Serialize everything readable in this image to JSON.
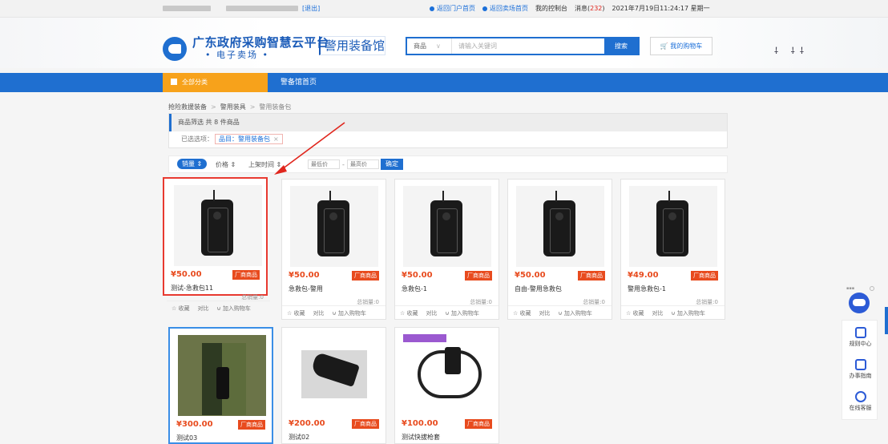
{
  "topbar": {
    "logout": "[退出]",
    "links": [
      "返回门户首页",
      "返回卖场首页",
      "我的控制台"
    ],
    "messages_label": "消息(",
    "messages_count": "232",
    "messages_close": ")",
    "datetime": "2021年7月19日11:24:17 星期一"
  },
  "header": {
    "title": "广东政府采购智慧云平台",
    "subtitle": "• 电子卖场 •",
    "section": "警用装备馆",
    "search": {
      "category": "商品",
      "placeholder": "请输入关键词",
      "button": "搜索"
    },
    "cart": "我的购物车"
  },
  "nav": {
    "all": "全部分类",
    "home": "警备馆首页"
  },
  "breadcrumb": [
    "抢险救援装备",
    "警用装具",
    "警用装备包"
  ],
  "filter": {
    "result_label": "商品筛选 共 8 件商品",
    "selected_label": "已选选项：",
    "selected_tag": "品目：警用装备包"
  },
  "sort": {
    "options": [
      "销量",
      "价格",
      "上架时间"
    ],
    "price_min_placeholder": "最低价",
    "price_max_placeholder": "最高价",
    "confirm": "确定"
  },
  "products": [
    {
      "name": "测试-急救包11",
      "price": "¥50.00",
      "badge": "厂商商品",
      "sold": "总销量:0"
    },
    {
      "name": "急救包-警用",
      "price": "¥50.00",
      "badge": "厂商商品",
      "sold": "总销量:0"
    },
    {
      "name": "急救包-1",
      "price": "¥50.00",
      "badge": "厂商商品",
      "sold": "总销量:0"
    },
    {
      "name": "自由-警用急救包",
      "price": "¥50.00",
      "badge": "厂商商品",
      "sold": "总销量:0"
    },
    {
      "name": "警用急救包-1",
      "price": "¥49.00",
      "badge": "厂商商品",
      "sold": "总销量:0"
    },
    {
      "name": "测试03",
      "price": "¥300.00",
      "badge": "厂商商品"
    },
    {
      "name": "测试02",
      "price": "¥200.00",
      "badge": "厂商商品"
    },
    {
      "name": "测试快拔枪套",
      "price": "¥100.00",
      "badge": "厂商商品"
    }
  ],
  "card_actions": [
    "☆ 收藏",
    "对比",
    "⊍ 加入购物车"
  ],
  "side": [
    "规则中心",
    "办事指南",
    "在线客服"
  ]
}
